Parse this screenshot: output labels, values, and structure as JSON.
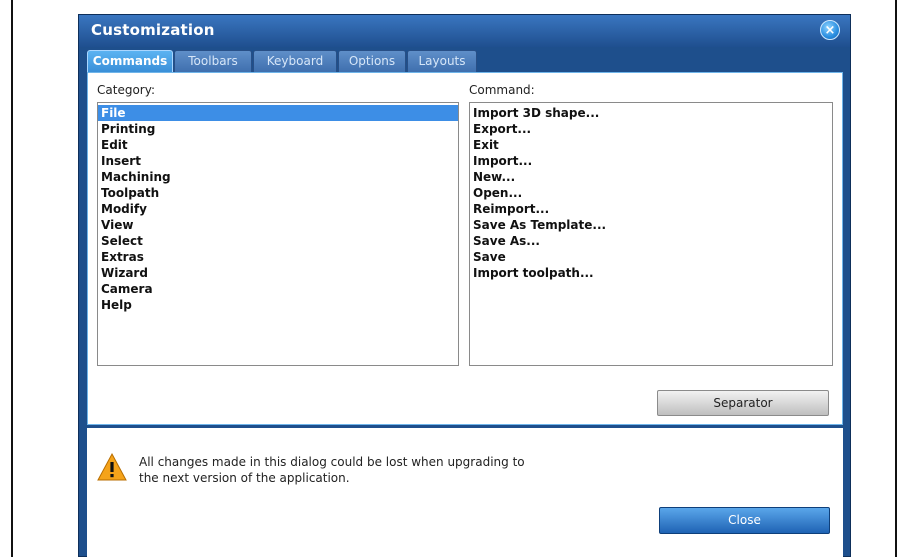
{
  "dialog": {
    "title": "Customization",
    "close_icon": "close-icon"
  },
  "tabs": [
    {
      "label": "Commands",
      "active": true
    },
    {
      "label": "Toolbars",
      "active": false
    },
    {
      "label": "Keyboard",
      "active": false
    },
    {
      "label": "Options",
      "active": false
    },
    {
      "label": "Layouts",
      "active": false
    }
  ],
  "category": {
    "label": "Category:",
    "items": [
      "File",
      "Printing",
      "Edit",
      "Insert",
      "Machining",
      "Toolpath",
      "Modify",
      "View",
      "Select",
      "Extras",
      "Wizard",
      "Camera",
      "Help"
    ],
    "selected": "File"
  },
  "command": {
    "label": "Command:",
    "items": [
      "Import 3D shape...",
      "Export...",
      "Exit",
      "Import...",
      "New...",
      "Open...",
      "Reimport...",
      "Save As Template...",
      "Save As...",
      "Save",
      "Import toolpath..."
    ]
  },
  "buttons": {
    "separator": "Separator",
    "close": "Close"
  },
  "warning": {
    "icon": "warning-icon",
    "line1": "All changes made in this dialog could be lost when upgrading to",
    "line2": "the next version of the application."
  },
  "colors": {
    "dialog_bg": "#1e4f8c",
    "accent": "#3d8ee6",
    "warning": "#f5a31a"
  }
}
